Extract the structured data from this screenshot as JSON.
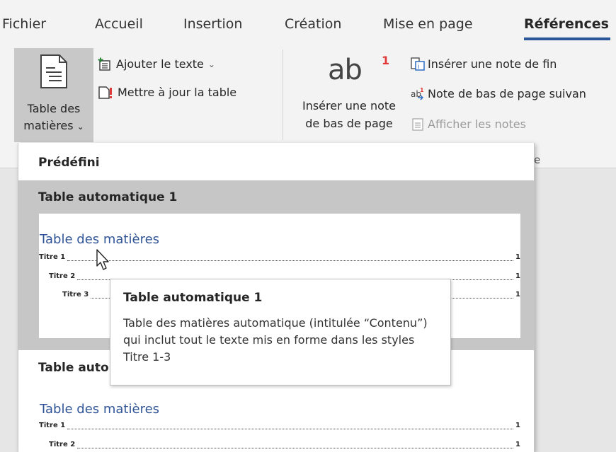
{
  "tabs": [
    {
      "label": "Fichier"
    },
    {
      "label": "Accueil"
    },
    {
      "label": "Insertion"
    },
    {
      "label": "Création"
    },
    {
      "label": "Mise en page"
    },
    {
      "label": "Références"
    }
  ],
  "active_tab": "Références",
  "ribbon": {
    "toc_button": {
      "line1": "Table des",
      "line2": "matières",
      "chevron": "⌄",
      "icon": "table-of-contents-icon"
    },
    "add_text": {
      "label": "Ajouter le texte",
      "chevron": "⌄",
      "icon": "add-text-icon"
    },
    "update_table": {
      "label": "Mettre à jour la table",
      "icon": "update-table-icon"
    },
    "insert_footnote": {
      "big_text": "ab",
      "sup": "1",
      "line1": "Insérer une note",
      "line2": "de bas de page"
    },
    "insert_endnote": {
      "label": "Insérer une note de fin",
      "icon": "insert-endnote-icon"
    },
    "next_footnote": {
      "label": "Note de bas de page suivan",
      "icon": "next-footnote-icon"
    },
    "show_notes": {
      "label": "Afficher les notes",
      "icon": "show-notes-icon",
      "disabled": true
    },
    "group_label_fragment": "e"
  },
  "gallery": {
    "section_header": "Prédéfini",
    "items": [
      {
        "title": "Table automatique 1",
        "preview_heading": "Table des matières",
        "lines": [
          {
            "name": "Titre 1",
            "page": "1"
          },
          {
            "name": "Titre 2",
            "page": "1"
          },
          {
            "name": "Titre 3",
            "page": "1"
          }
        ]
      },
      {
        "title": "Table automatique 2",
        "preview_heading": "Table des matières",
        "lines": [
          {
            "name": "Titre 1",
            "page": "1"
          },
          {
            "name": "Titre 2",
            "page": "1"
          }
        ]
      }
    ]
  },
  "tooltip": {
    "title": "Table automatique 1",
    "body": "Table des matières automatique (intitulée “Contenu”) qui inclut tout le texte mis en forme dans les styles Titre 1-3"
  },
  "colors": {
    "accent": "#2b579a",
    "heading_blue": "#2f5496",
    "hover_gray": "#c6c6c6",
    "ribbon_bg": "#f3f3f3"
  }
}
